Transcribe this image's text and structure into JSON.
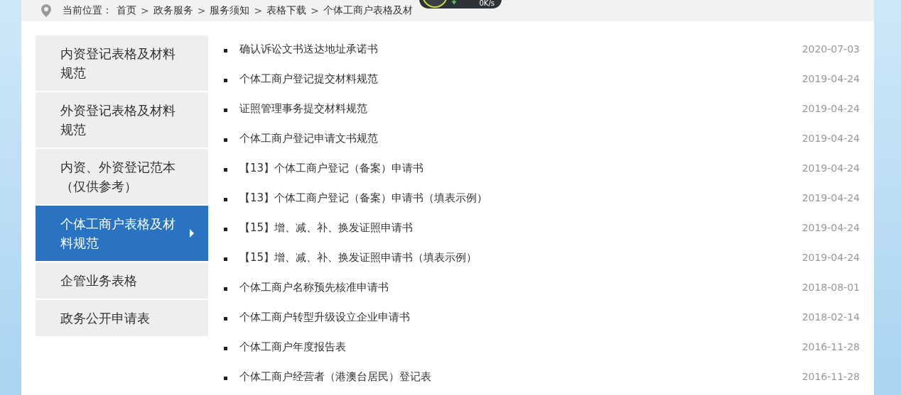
{
  "breadcrumb": {
    "label": "当前位置：",
    "separator": ">",
    "items": [
      "首页",
      "政务服务",
      "服务须知",
      "表格下载",
      "个体工商户表格及材"
    ]
  },
  "speed_widget": {
    "reading": "0K/s"
  },
  "sidebar": {
    "items": [
      {
        "label": "内资登记表格及材料规范",
        "selected": false
      },
      {
        "label": "外资登记表格及材料规范",
        "selected": false
      },
      {
        "label": "内资、外资登记范本（仅供参考）",
        "selected": false
      },
      {
        "label": "个体工商户表格及材料规范",
        "selected": true
      },
      {
        "label": "企管业务表格",
        "selected": false
      },
      {
        "label": "政务公开申请表",
        "selected": false
      }
    ]
  },
  "documents": [
    {
      "title": "确认诉讼文书送达地址承诺书",
      "date": "2020-07-03"
    },
    {
      "title": "个体工商户登记提交材料规范",
      "date": "2019-04-24"
    },
    {
      "title": "证照管理事务提交材料规范",
      "date": "2019-04-24"
    },
    {
      "title": "个体工商户登记申请文书规范",
      "date": "2019-04-24"
    },
    {
      "title": "【13】个体工商户登记（备案）申请书",
      "date": "2019-04-24"
    },
    {
      "title": "【13】个体工商户登记（备案）申请书（填表示例）",
      "date": "2019-04-24"
    },
    {
      "title": "【15】增、减、补、换发证照申请书",
      "date": "2019-04-24"
    },
    {
      "title": "【15】增、减、补、换发证照申请书（填表示例）",
      "date": "2019-04-24"
    },
    {
      "title": "个体工商户名称预先核准申请书",
      "date": "2018-08-01"
    },
    {
      "title": "个体工商户转型升级设立企业申请书",
      "date": "2018-02-14"
    },
    {
      "title": "个体工商户年度报告表",
      "date": "2016-11-28"
    },
    {
      "title": "个体工商户经营者（港澳台居民）登记表",
      "date": "2016-11-28"
    }
  ]
}
